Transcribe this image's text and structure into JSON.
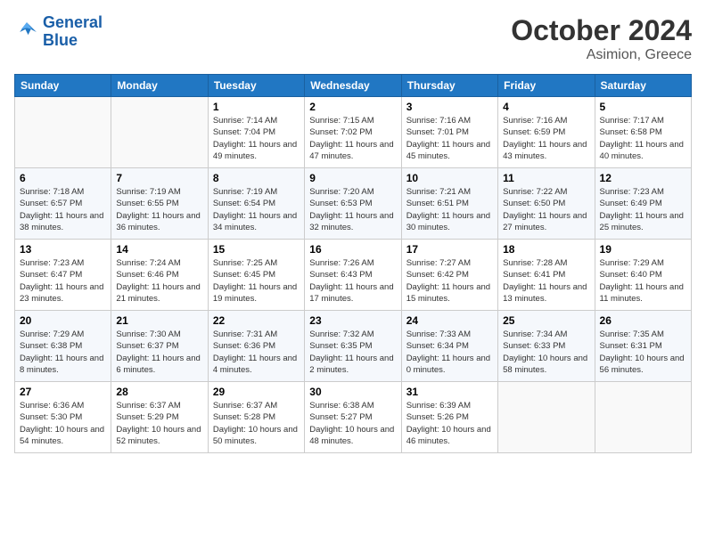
{
  "header": {
    "logo_line1": "General",
    "logo_line2": "Blue",
    "month": "October 2024",
    "location": "Asimion, Greece"
  },
  "weekdays": [
    "Sunday",
    "Monday",
    "Tuesday",
    "Wednesday",
    "Thursday",
    "Friday",
    "Saturday"
  ],
  "weeks": [
    [
      {
        "day": "",
        "info": ""
      },
      {
        "day": "",
        "info": ""
      },
      {
        "day": "1",
        "info": "Sunrise: 7:14 AM\nSunset: 7:04 PM\nDaylight: 11 hours and 49 minutes."
      },
      {
        "day": "2",
        "info": "Sunrise: 7:15 AM\nSunset: 7:02 PM\nDaylight: 11 hours and 47 minutes."
      },
      {
        "day": "3",
        "info": "Sunrise: 7:16 AM\nSunset: 7:01 PM\nDaylight: 11 hours and 45 minutes."
      },
      {
        "day": "4",
        "info": "Sunrise: 7:16 AM\nSunset: 6:59 PM\nDaylight: 11 hours and 43 minutes."
      },
      {
        "day": "5",
        "info": "Sunrise: 7:17 AM\nSunset: 6:58 PM\nDaylight: 11 hours and 40 minutes."
      }
    ],
    [
      {
        "day": "6",
        "info": "Sunrise: 7:18 AM\nSunset: 6:57 PM\nDaylight: 11 hours and 38 minutes."
      },
      {
        "day": "7",
        "info": "Sunrise: 7:19 AM\nSunset: 6:55 PM\nDaylight: 11 hours and 36 minutes."
      },
      {
        "day": "8",
        "info": "Sunrise: 7:19 AM\nSunset: 6:54 PM\nDaylight: 11 hours and 34 minutes."
      },
      {
        "day": "9",
        "info": "Sunrise: 7:20 AM\nSunset: 6:53 PM\nDaylight: 11 hours and 32 minutes."
      },
      {
        "day": "10",
        "info": "Sunrise: 7:21 AM\nSunset: 6:51 PM\nDaylight: 11 hours and 30 minutes."
      },
      {
        "day": "11",
        "info": "Sunrise: 7:22 AM\nSunset: 6:50 PM\nDaylight: 11 hours and 27 minutes."
      },
      {
        "day": "12",
        "info": "Sunrise: 7:23 AM\nSunset: 6:49 PM\nDaylight: 11 hours and 25 minutes."
      }
    ],
    [
      {
        "day": "13",
        "info": "Sunrise: 7:23 AM\nSunset: 6:47 PM\nDaylight: 11 hours and 23 minutes."
      },
      {
        "day": "14",
        "info": "Sunrise: 7:24 AM\nSunset: 6:46 PM\nDaylight: 11 hours and 21 minutes."
      },
      {
        "day": "15",
        "info": "Sunrise: 7:25 AM\nSunset: 6:45 PM\nDaylight: 11 hours and 19 minutes."
      },
      {
        "day": "16",
        "info": "Sunrise: 7:26 AM\nSunset: 6:43 PM\nDaylight: 11 hours and 17 minutes."
      },
      {
        "day": "17",
        "info": "Sunrise: 7:27 AM\nSunset: 6:42 PM\nDaylight: 11 hours and 15 minutes."
      },
      {
        "day": "18",
        "info": "Sunrise: 7:28 AM\nSunset: 6:41 PM\nDaylight: 11 hours and 13 minutes."
      },
      {
        "day": "19",
        "info": "Sunrise: 7:29 AM\nSunset: 6:40 PM\nDaylight: 11 hours and 11 minutes."
      }
    ],
    [
      {
        "day": "20",
        "info": "Sunrise: 7:29 AM\nSunset: 6:38 PM\nDaylight: 11 hours and 8 minutes."
      },
      {
        "day": "21",
        "info": "Sunrise: 7:30 AM\nSunset: 6:37 PM\nDaylight: 11 hours and 6 minutes."
      },
      {
        "day": "22",
        "info": "Sunrise: 7:31 AM\nSunset: 6:36 PM\nDaylight: 11 hours and 4 minutes."
      },
      {
        "day": "23",
        "info": "Sunrise: 7:32 AM\nSunset: 6:35 PM\nDaylight: 11 hours and 2 minutes."
      },
      {
        "day": "24",
        "info": "Sunrise: 7:33 AM\nSunset: 6:34 PM\nDaylight: 11 hours and 0 minutes."
      },
      {
        "day": "25",
        "info": "Sunrise: 7:34 AM\nSunset: 6:33 PM\nDaylight: 10 hours and 58 minutes."
      },
      {
        "day": "26",
        "info": "Sunrise: 7:35 AM\nSunset: 6:31 PM\nDaylight: 10 hours and 56 minutes."
      }
    ],
    [
      {
        "day": "27",
        "info": "Sunrise: 6:36 AM\nSunset: 5:30 PM\nDaylight: 10 hours and 54 minutes."
      },
      {
        "day": "28",
        "info": "Sunrise: 6:37 AM\nSunset: 5:29 PM\nDaylight: 10 hours and 52 minutes."
      },
      {
        "day": "29",
        "info": "Sunrise: 6:37 AM\nSunset: 5:28 PM\nDaylight: 10 hours and 50 minutes."
      },
      {
        "day": "30",
        "info": "Sunrise: 6:38 AM\nSunset: 5:27 PM\nDaylight: 10 hours and 48 minutes."
      },
      {
        "day": "31",
        "info": "Sunrise: 6:39 AM\nSunset: 5:26 PM\nDaylight: 10 hours and 46 minutes."
      },
      {
        "day": "",
        "info": ""
      },
      {
        "day": "",
        "info": ""
      }
    ]
  ]
}
